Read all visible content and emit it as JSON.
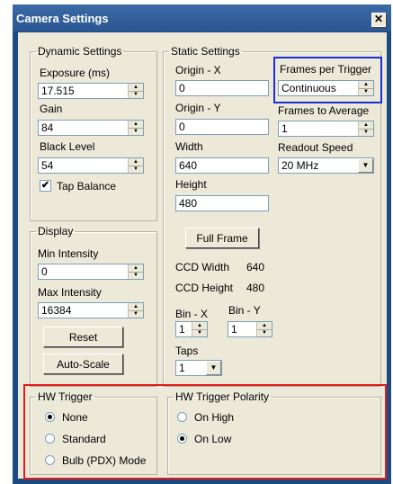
{
  "window": {
    "title": "Camera Settings",
    "close_glyph": "✕"
  },
  "dynamic": {
    "legend": "Dynamic Settings",
    "exposure_label": "Exposure (ms)",
    "exposure_value": "17.515",
    "gain_label": "Gain",
    "gain_value": "84",
    "black_level_label": "Black Level",
    "black_level_value": "54",
    "tap_balance_label": "Tap Balance",
    "tap_balance_checked": true
  },
  "static": {
    "legend": "Static Settings",
    "origin_x_label": "Origin - X",
    "origin_x_value": "0",
    "origin_y_label": "Origin - Y",
    "origin_y_value": "0",
    "width_label": "Width",
    "width_value": "640",
    "height_label": "Height",
    "height_value": "480",
    "fpt_label": "Frames per Trigger",
    "fpt_value": "Continuous",
    "fta_label": "Frames to Average",
    "fta_value": "1",
    "readout_label": "Readout Speed",
    "readout_value": "20 MHz",
    "full_frame_label": "Full Frame",
    "ccd_width_label": "CCD Width",
    "ccd_width_value": "640",
    "ccd_height_label": "CCD Height",
    "ccd_height_value": "480",
    "bin_x_label": "Bin - X",
    "bin_x_value": "1",
    "bin_y_label": "Bin - Y",
    "bin_y_value": "1",
    "taps_label": "Taps",
    "taps_value": "1"
  },
  "display": {
    "legend": "Display",
    "min_label": "Min Intensity",
    "min_value": "0",
    "max_label": "Max Intensity",
    "max_value": "16384",
    "reset_label": "Reset",
    "autoscale_label": "Auto-Scale"
  },
  "hw_trigger": {
    "legend": "HW Trigger",
    "options": [
      "None",
      "Standard",
      "Bulb (PDX) Mode"
    ],
    "selected": "None"
  },
  "hw_polarity": {
    "legend": "HW Trigger Polarity",
    "options": [
      "On High",
      "On Low"
    ],
    "selected": "On Low"
  },
  "colors": {
    "titlebar": "#2a5691",
    "face": "#ece9d8",
    "highlight_blue": "#1a2fd6",
    "highlight_red": "#e01b1b"
  },
  "icons": {
    "spin_up": "▲",
    "spin_down": "▼",
    "dropdown": "▼",
    "check": "✔"
  }
}
